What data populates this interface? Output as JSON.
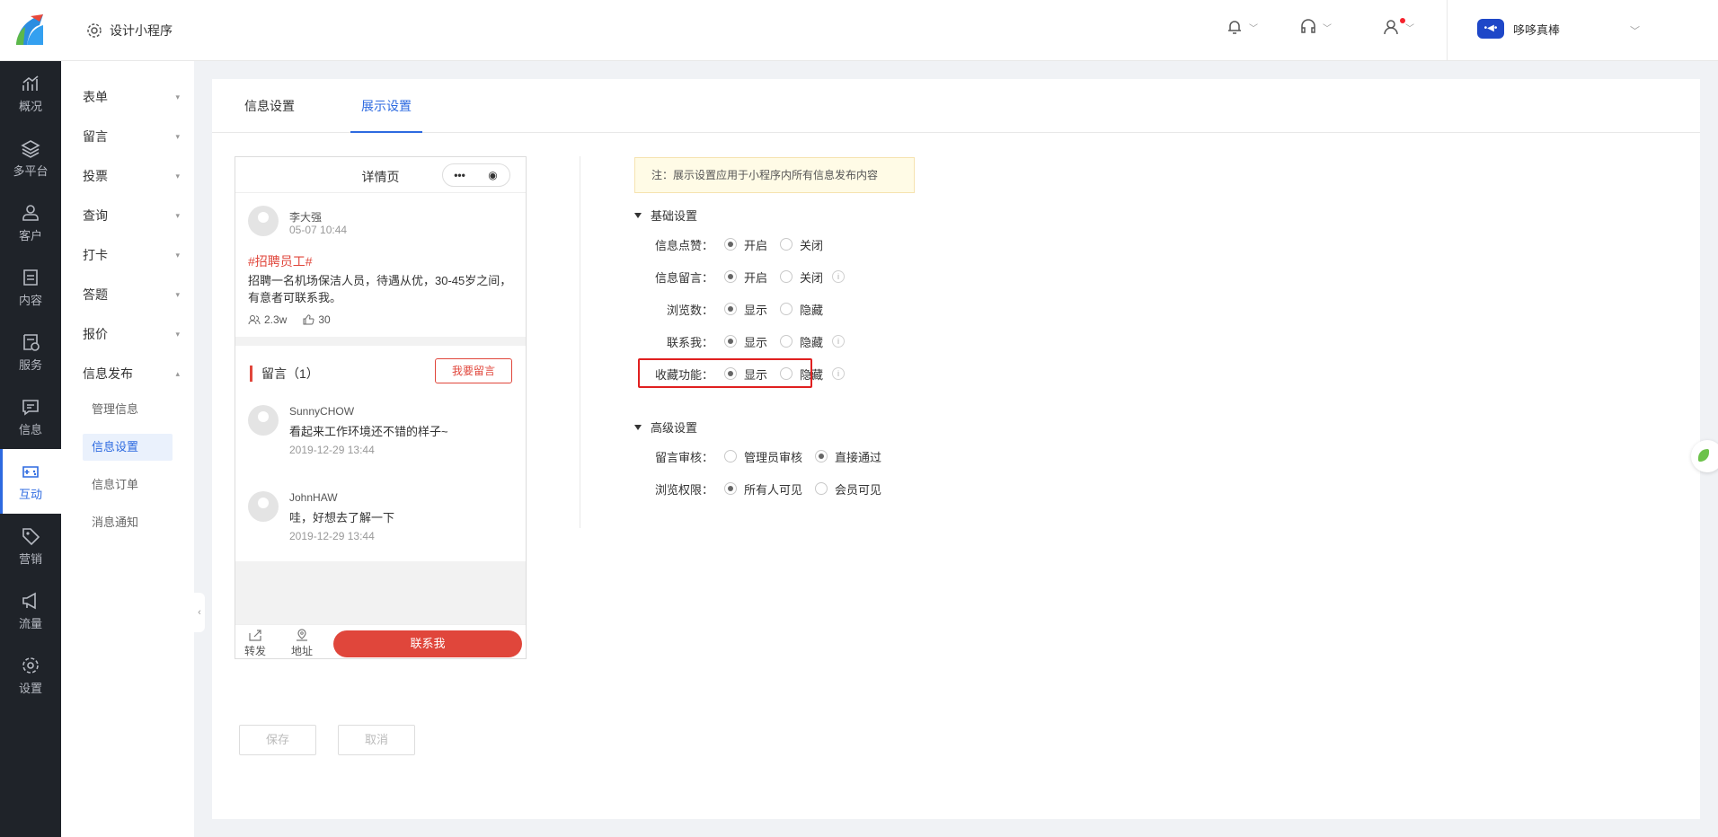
{
  "header": {
    "app_title": "设计小程序",
    "account_name": "哆哆真棒",
    "account_badge": "•◀•"
  },
  "sidebar": {
    "items": [
      {
        "label": "概况",
        "icon": "chart-icon"
      },
      {
        "label": "多平台",
        "icon": "layers-icon"
      },
      {
        "label": "客户",
        "icon": "user-icon"
      },
      {
        "label": "内容",
        "icon": "document-icon"
      },
      {
        "label": "服务",
        "icon": "service-icon"
      },
      {
        "label": "信息",
        "icon": "message-icon"
      },
      {
        "label": "互动",
        "icon": "gamepad-icon"
      },
      {
        "label": "营销",
        "icon": "tag-icon"
      },
      {
        "label": "流量",
        "icon": "megaphone-icon"
      },
      {
        "label": "设置",
        "icon": "gear-icon"
      }
    ],
    "active": "互动"
  },
  "subnav": {
    "groups": [
      "表单",
      "留言",
      "投票",
      "查询",
      "打卡",
      "答题",
      "报价",
      "信息发布"
    ],
    "children": [
      "管理信息",
      "信息设置",
      "信息订单",
      "消息通知"
    ],
    "active_child": "信息设置"
  },
  "tabs": {
    "items": [
      "信息设置",
      "展示设置"
    ],
    "active": "展示设置"
  },
  "preview": {
    "nav_title": "详情页",
    "capsule_more": "•••",
    "capsule_close": "◉",
    "post": {
      "author": "李大强",
      "time": "05-07 10:44",
      "tag": "#招聘员工#",
      "body": "招聘一名机场保洁人员，待遇从优，30-45岁之间，有意者可联系我。",
      "views": "2.3w",
      "likes": "30"
    },
    "comments_title": "留言（1）",
    "leave_comment_button": "我要留言",
    "comments": [
      {
        "name": "SunnyCHOW",
        "text": "看起来工作环境还不错的样子~",
        "time": "2019-12-29 13:44"
      },
      {
        "name": "JohnHAW",
        "text": "哇，好想去了解一下",
        "time": "2019-12-29 13:44"
      }
    ],
    "bottom": {
      "share": "转发",
      "address": "地址",
      "contact": "联系我"
    }
  },
  "settings": {
    "note": "注：展示设置应用于小程序内所有信息发布内容",
    "basic_title": "基础设置",
    "advanced_title": "高级设置",
    "basic_rows": [
      {
        "label": "信息点赞：",
        "options": [
          "开启",
          "关闭"
        ],
        "selected": 0,
        "info": false
      },
      {
        "label": "信息留言：",
        "options": [
          "开启",
          "关闭"
        ],
        "selected": 0,
        "info": true
      },
      {
        "label": "浏览数：",
        "options": [
          "显示",
          "隐藏"
        ],
        "selected": 0,
        "info": false
      },
      {
        "label": "联系我：",
        "options": [
          "显示",
          "隐藏"
        ],
        "selected": 0,
        "info": true
      },
      {
        "label": "收藏功能：",
        "options": [
          "显示",
          "隐藏"
        ],
        "selected": 0,
        "info": true
      }
    ],
    "advanced_rows": [
      {
        "label": "留言审核：",
        "options": [
          "管理员审核",
          "直接通过"
        ],
        "selected": 1
      },
      {
        "label": "浏览权限：",
        "options": [
          "所有人可见",
          "会员可见"
        ],
        "selected": 0
      }
    ],
    "info_glyph": "i"
  },
  "actions": {
    "save": "保存",
    "cancel": "取消"
  },
  "colors": {
    "accent": "#2d6ae0",
    "brand_red": "#e0463b",
    "highlight_border": "#e02020",
    "sidebar_bg": "#1f2329"
  }
}
